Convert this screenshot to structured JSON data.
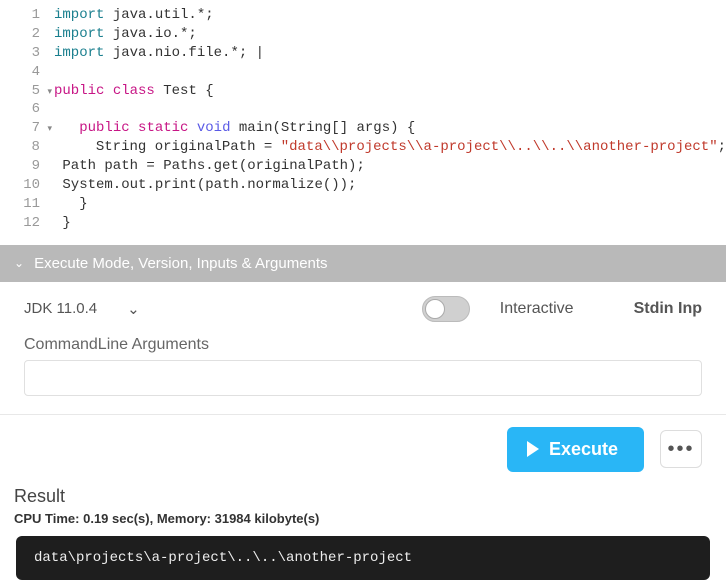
{
  "code": {
    "lines": [
      {
        "n": "1",
        "fold": "",
        "html": "<span class='kw-import'>import</span> java.util.*;"
      },
      {
        "n": "2",
        "fold": "",
        "html": "<span class='kw-import'>import</span> java.io.*;"
      },
      {
        "n": "3",
        "fold": "",
        "html": "<span class='kw-import'>import</span> java.nio.file.*; |"
      },
      {
        "n": "4",
        "fold": "",
        "html": ""
      },
      {
        "n": "5",
        "fold": "▾",
        "html": "<span class='kw-mod'>public</span> <span class='kw-mod'>class</span> <span class='ident'>Test</span> {"
      },
      {
        "n": "6",
        "fold": "",
        "html": ""
      },
      {
        "n": "7",
        "fold": "▾",
        "html": "   <span class='kw-mod'>public</span> <span class='kw-mod'>static</span> <span class='kw-type'>void</span> main(String[] args) {"
      },
      {
        "n": "8",
        "fold": "",
        "html": "     String originalPath = <span class='str'>\"data\\\\projects\\\\a-project\\\\..\\\\..\\\\another-project\"</span>;"
      },
      {
        "n": "9",
        "fold": "",
        "html": " Path path = Paths.get(originalPath);"
      },
      {
        "n": "10",
        "fold": "",
        "html": " System.out.print(path.normalize());"
      },
      {
        "n": "11",
        "fold": "",
        "html": "   }"
      },
      {
        "n": "12",
        "fold": "",
        "html": " }"
      }
    ]
  },
  "panel": {
    "title": "Execute Mode, Version, Inputs & Arguments"
  },
  "settings": {
    "jdk_label": "JDK 11.0.4",
    "interactive_label": "Interactive",
    "stdin_label": "Stdin Inp"
  },
  "args": {
    "label": "CommandLine Arguments",
    "value": ""
  },
  "actions": {
    "execute_label": "Execute"
  },
  "result": {
    "title": "Result",
    "stats": "CPU Time: 0.19 sec(s), Memory: 31984 kilobyte(s)",
    "output": "data\\projects\\a-project\\..\\..\\another-project"
  }
}
